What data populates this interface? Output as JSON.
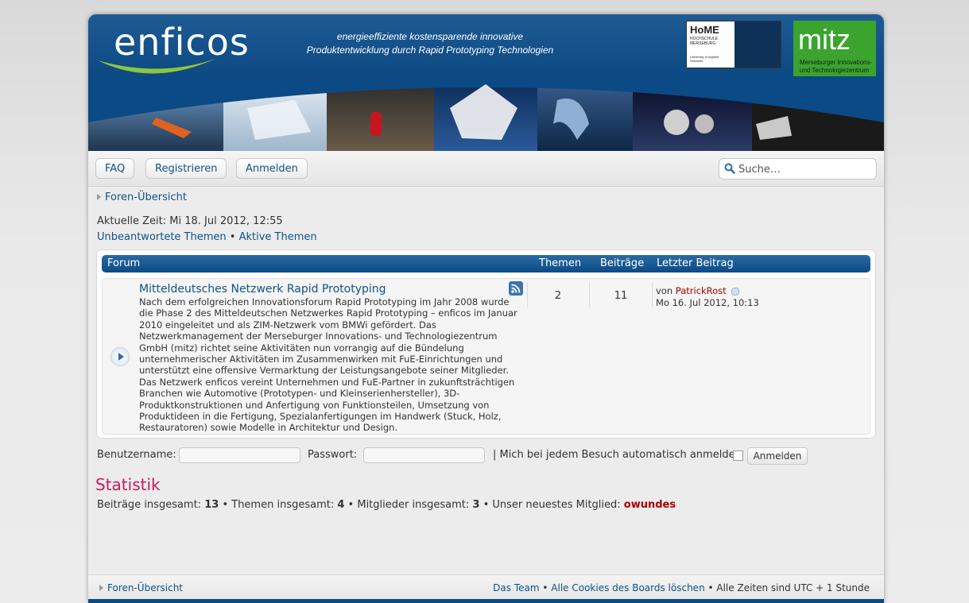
{
  "header": {
    "logo_text": "enficos",
    "tagline_line1": "energieeffiziente kostensparende innovative",
    "tagline_line2": "Produktentwicklung durch Rapid Prototyping Technologien",
    "home_logo": {
      "title": "HoME",
      "subtitle": "HOCHSCHULE MERSEBURG",
      "note": "University of Applied Sciences"
    },
    "mitz_logo": {
      "title": "mitz",
      "subtitle": "Merseburger Innovations- und Technologiezentrum"
    }
  },
  "navbar": {
    "faq": "FAQ",
    "register": "Registrieren",
    "login": "Anmelden",
    "search_placeholder": "Suche…",
    "search_icon": "search-icon"
  },
  "breadcrumb": "Foren-Übersicht",
  "time_text": "Aktuelle Zeit: Mi 18. Jul 2012, 12:55",
  "quicklinks": {
    "unanswered": "Unbeantwortete Themen",
    "sep": "•",
    "active": "Aktive Themen"
  },
  "forum_table": {
    "headers": {
      "forum": "Forum",
      "topics": "Themen",
      "posts": "Beiträge",
      "last_post": "Letzter Beitrag"
    },
    "row": {
      "title": "Mitteldeutsches Netzwerk Rapid Prototyping",
      "description": "Nach dem erfolgreichen Innovationsforum Rapid Prototyping im Jahr 2008 wurde die Phase 2 des Mitteldeutschen Netzwerkes Rapid Prototyping – enficos im Januar 2010 eingeleitet und als ZIM-Netzwerk vom BMWi gefördert. Das Netzwerkmanagement der Merseburger Innovations- und Technologiezentrum GmbH (mitz) richtet seine Aktivitäten nun vorrangig auf die Bündelung unternehmerischer Aktivitäten im Zusammenwirken mit FuE-Einrichtungen und unterstützt eine offensive Vermarktung der Leistungsangebote seiner Mitglieder. Das Netzwerk enficos vereint Unternehmen und FuE-Partner in zukunftsträchtigen Branchen wie Automotive (Prototypen- und Kleinserienhersteller), 3D-Produktkonstruktionen und Anfertigung von Funktionsteilen, Umsetzung von Produktideen in die Fertigung, Spezialanfertigungen im Handwerk (Stuck, Holz, Restauratoren) sowie Modelle in Architektur und Design.",
      "topics": "2",
      "posts": "11",
      "last_post_by": "von",
      "last_post_user": "PatrickRost",
      "last_post_date": "Mo 16. Jul 2012, 10:13"
    }
  },
  "login": {
    "username_label": "Benutzername:",
    "password_label": "Passwort:",
    "autologin_label": "| Mich bei jedem Besuch automatisch anmelden",
    "submit": "Anmelden"
  },
  "stats": {
    "title": "Statistik",
    "posts_label": "Beiträge insgesamt:",
    "posts": "13",
    "topics_label": "• Themen insgesamt:",
    "topics": "4",
    "members_label": "• Mitglieder insgesamt:",
    "members": "3",
    "newest_label": "• Unser neuestes Mitglied:",
    "newest": "owundes"
  },
  "footer": {
    "breadcrumb": "Foren-Übersicht",
    "team": "Das Team",
    "sep": "•",
    "cookies": "Alle Cookies des Boards löschen",
    "timezone": "• Alle Zeiten sind UTC + 1 Stunde"
  }
}
